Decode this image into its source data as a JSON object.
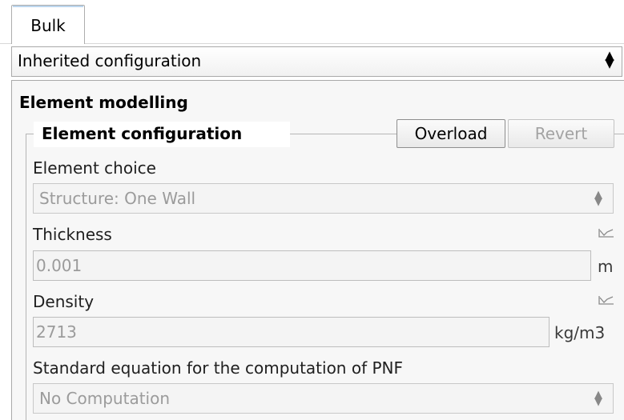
{
  "tabs": [
    {
      "label": "Bulk"
    }
  ],
  "config_combo": {
    "value": "Inherited configuration"
  },
  "section": {
    "title": "Element modelling"
  },
  "group": {
    "title": "Element configuration",
    "overload_label": "Overload",
    "revert_label": "Revert"
  },
  "fields": {
    "element_choice": {
      "label": "Element choice",
      "value": "Structure: One Wall"
    },
    "thickness": {
      "label": "Thickness",
      "value": "0.001",
      "unit": "m"
    },
    "density": {
      "label": "Density",
      "value": "2713",
      "unit": "kg/m3"
    },
    "pnf_equation": {
      "label": "Standard equation for the computation of PNF",
      "value": "No Computation"
    }
  },
  "icons": {
    "updown": "updown-arrows-icon",
    "curve": "curve-graph-icon"
  }
}
